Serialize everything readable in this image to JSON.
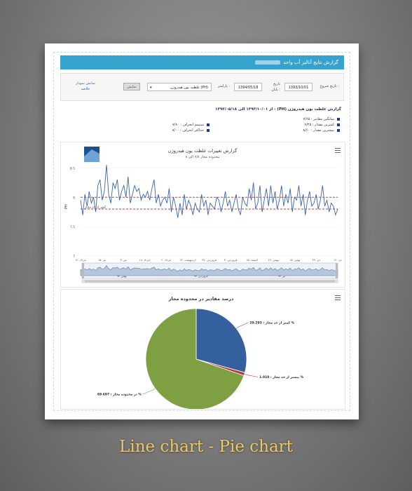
{
  "header": {
    "title": "گزارش نتایج آنالیز آب واحد"
  },
  "form": {
    "start_label": "تاریخ شروع :",
    "start_value": "1393/10/01",
    "end_label": "تاریخ پایان :",
    "end_value": "1394/05/18",
    "param_label": "پارامتر :",
    "param_value": "غلظت یون هیدروژن (PH)",
    "show_button": "نمایش",
    "chart_link": "نمایش نمودار خلاصه"
  },
  "summary": {
    "title": "گزارش غلظت یون هیدروژن (PH) - از ۱۳۹۳/۱۰/۰۱ الی ۱۳۹۴/۰۵/۱۸",
    "stats": [
      "میانگین مقادیر : ۷/۶۵",
      "کمترین مقدار : ۷/۲۵",
      "بیشترین مقدار : ۸/۶۰",
      "مینیمم انحراف : ۷/۸۰",
      "حداکثر انحراف : ۸/۰۰"
    ]
  },
  "colors": {
    "line": "#3b64a8",
    "limit": "#d43a3a",
    "pie_blue": "#34609e",
    "pie_red": "#b53a3a",
    "pie_green": "#7ea043",
    "header": "#36a3cf"
  },
  "chart_data": [
    {
      "type": "line",
      "title": "گزارش تغییرات غلظت یون هیدروژن",
      "subtitle": "محدوده مجاز ۷/۸ الی ۸",
      "ylabel": "PH",
      "ylim": [
        7,
        8.6
      ],
      "yticks": [
        "8.5",
        "8",
        "7.5",
        "7"
      ],
      "limits": [
        7.8,
        8.0
      ],
      "limit_label": "کمتر از حد مجاز",
      "xticks": [
        "۱۲. دی",
        "۲۹. دی",
        "۱۵. بهمن",
        "۲۷. بهمن",
        "۱۵. اسفند",
        "۳. فروردین",
        "۲۷. فروردین",
        "۱۳. اردیبهشت",
        "۲. خرداد",
        "۱۸. خرداد",
        "۳. تیر",
        "۱۵. تیر",
        "۱۲. مرداد"
      ],
      "navigator_labels": [
        "بهمن ۹۳",
        "فروردین ۹۴",
        "تیر ۹۴"
      ],
      "x": [
        1,
        2,
        3,
        4,
        5,
        6,
        7,
        8,
        9,
        10,
        11,
        12,
        13,
        14,
        15,
        16,
        17,
        18,
        19,
        20,
        21,
        22,
        23,
        24,
        25,
        26,
        27,
        28,
        29,
        30,
        31,
        32,
        33,
        34,
        35,
        36,
        37,
        38,
        39,
        40,
        41,
        42,
        43,
        44,
        45,
        46,
        47,
        48,
        49,
        50,
        51,
        52,
        53,
        54,
        55,
        56,
        57,
        58,
        59,
        60,
        61,
        62,
        63,
        64,
        65,
        66,
        67,
        68,
        69,
        70,
        71,
        72,
        73,
        74,
        75,
        76,
        77,
        78,
        79,
        80,
        81,
        82,
        83,
        84,
        85,
        86,
        87,
        88,
        89,
        90,
        91,
        92,
        93,
        94,
        95,
        96,
        97,
        98,
        99,
        100,
        101,
        102,
        103,
        104,
        105,
        106,
        107,
        108,
        109,
        110,
        111,
        112,
        113,
        114,
        115,
        116,
        117,
        118,
        119,
        120
      ],
      "values": [
        7.95,
        7.7,
        8.05,
        7.85,
        8.1,
        7.9,
        8.0,
        7.75,
        8.2,
        8.3,
        7.95,
        8.1,
        8.55,
        8.05,
        7.9,
        8.25,
        8.15,
        8.3,
        7.95,
        8.1,
        8.2,
        8.0,
        8.35,
        7.9,
        8.05,
        8.2,
        8.1,
        8.15,
        7.95,
        8.05,
        8.0,
        8.1,
        7.95,
        8.15,
        8.3,
        7.9,
        8.05,
        7.85,
        7.95,
        8.0,
        7.9,
        8.15,
        7.75,
        8.0,
        7.85,
        7.65,
        7.9,
        7.7,
        8.05,
        7.8,
        7.95,
        7.85,
        7.7,
        7.9,
        7.8,
        7.75,
        8.05,
        7.85,
        7.95,
        7.7,
        7.9,
        7.85,
        7.8,
        8.0,
        7.95,
        7.75,
        7.9,
        8.1,
        7.85,
        7.95,
        7.75,
        7.9,
        8.05,
        7.8,
        7.7,
        8.0,
        7.9,
        7.85,
        8.15,
        7.95,
        8.25,
        7.8,
        7.9,
        8.2,
        7.75,
        7.95,
        8.15,
        7.85,
        8.2,
        7.9,
        8.1,
        7.8,
        7.95,
        8.2,
        7.85,
        8.05,
        7.9,
        8.15,
        7.75,
        8.0,
        7.95,
        8.2,
        7.85,
        8.05,
        7.7,
        7.95,
        8.1,
        7.85,
        7.9,
        8.05,
        7.8,
        7.95,
        8.2,
        7.85,
        7.95,
        7.75,
        7.9,
        7.85,
        7.7,
        7.8
      ]
    },
    {
      "type": "pie",
      "title": "درصد مقادیر در محدوده مجاز",
      "slices": [
        {
          "label": "کمتر از حد مجاز",
          "value": 29.293,
          "display": "کمتر از حد مجاز : 29.293 %"
        },
        {
          "label": "بیشتر از حد مجاز",
          "value": 1.01,
          "display": "بیشتر از حد مجاز : 1.010 %"
        },
        {
          "label": "در محدوده مجاز",
          "value": 69.697,
          "display": "در محدوده مجاز : 69.697 %"
        }
      ]
    }
  ],
  "caption": "Line chart - Pie chart"
}
